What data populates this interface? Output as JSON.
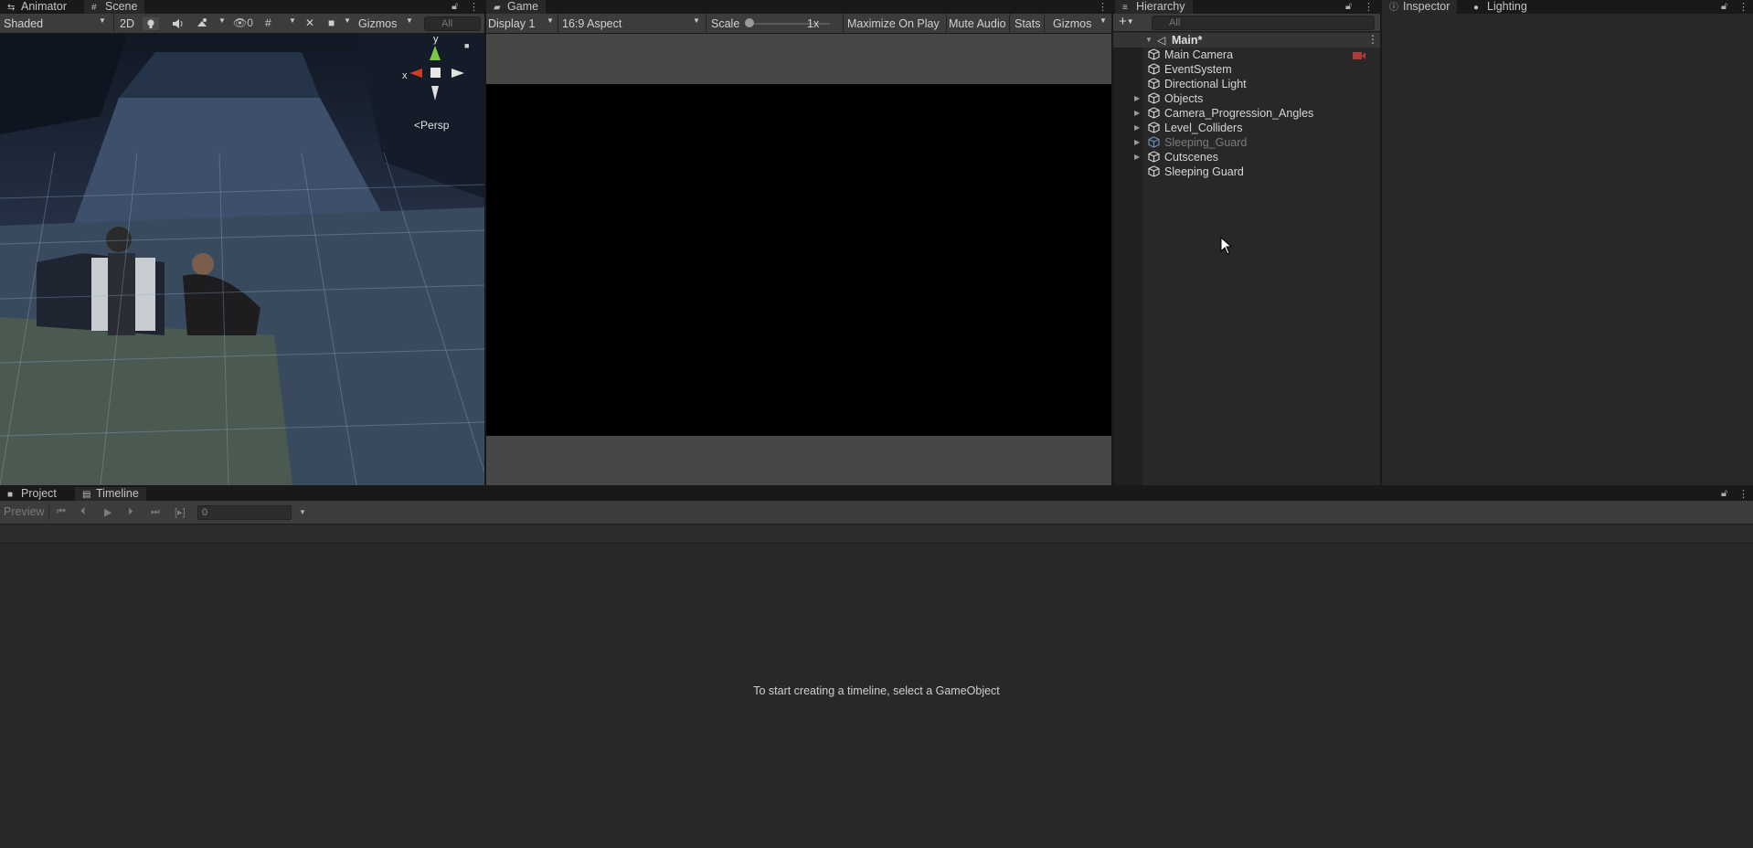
{
  "scene_panel": {
    "tabs": [
      {
        "label": "Animator",
        "icon": "animator-icon"
      },
      {
        "label": "Scene",
        "icon": "scene-grid-icon"
      }
    ],
    "shading_mode": "Shaded",
    "mode_2d": "2D",
    "hidden_count": "0",
    "gizmos_label": "Gizmos",
    "search_placeholder": "All",
    "gizmo_y": "y",
    "gizmo_x": "x",
    "projection": "Persp"
  },
  "game_panel": {
    "tab": {
      "label": "Game",
      "icon": "gamepad-icon"
    },
    "display": "Display 1",
    "aspect": "16:9 Aspect",
    "scale_label": "Scale",
    "scale_value": "1x",
    "maximize": "Maximize On Play",
    "mute": "Mute Audio",
    "stats": "Stats",
    "gizmos": "Gizmos"
  },
  "hierarchy": {
    "tab": {
      "label": "Hierarchy",
      "icon": "list-icon"
    },
    "search_placeholder": "All",
    "scene_name": "Main*",
    "items": [
      {
        "label": "Main Camera",
        "expandable": false,
        "active": true
      },
      {
        "label": "EventSystem",
        "expandable": false,
        "active": true
      },
      {
        "label": "Directional Light",
        "expandable": false,
        "active": true
      },
      {
        "label": "Objects",
        "expandable": true,
        "active": true
      },
      {
        "label": "Camera_Progression_Angles",
        "expandable": true,
        "active": true
      },
      {
        "label": "Level_Colliders",
        "expandable": true,
        "active": true
      },
      {
        "label": "Sleeping_Guard",
        "expandable": true,
        "active": false
      },
      {
        "label": "Cutscenes",
        "expandable": true,
        "active": true
      },
      {
        "label": "Sleeping Guard",
        "expandable": false,
        "active": true
      }
    ]
  },
  "inspector_panel": {
    "tabs": [
      {
        "label": "Inspector",
        "icon": "info-icon"
      },
      {
        "label": "Lighting",
        "icon": "bulb-icon"
      }
    ]
  },
  "timeline_panel": {
    "tabs": [
      {
        "label": "Project",
        "icon": "folder-icon"
      },
      {
        "label": "Timeline",
        "icon": "timeline-icon"
      }
    ],
    "preview_label": "Preview",
    "frame_value": "0",
    "empty_message": "To start creating a timeline, select a GameObject"
  },
  "colors": {
    "background": "#282828",
    "tab_strip": "#191919",
    "toolbar": "#3c3c3c",
    "game_view": "#000000",
    "gizmo_y": "#7ac943",
    "gizmo_x": "#d23a2a"
  }
}
